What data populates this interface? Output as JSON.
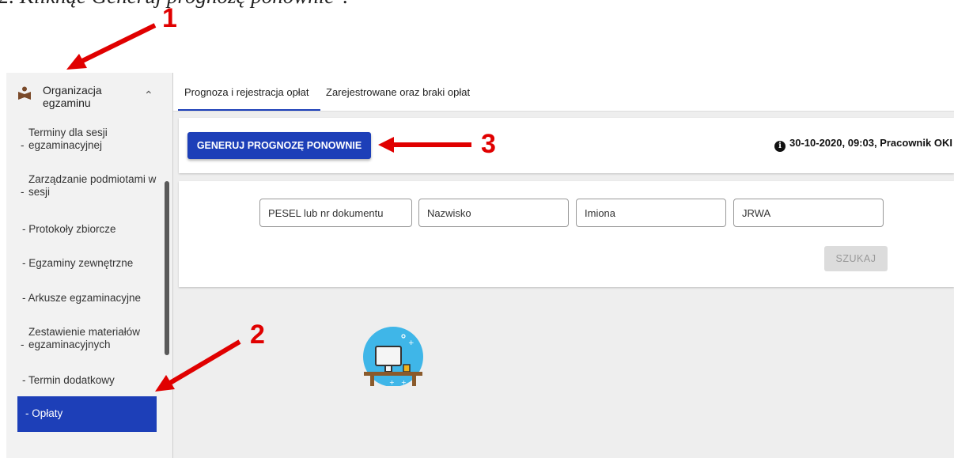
{
  "caption": "2.   Kliknąć Generuj prognozę ponownie\".",
  "sidebar": {
    "section_title": "Organizacja egzaminu",
    "items": [
      {
        "label": "Terminy dla sesji egzaminacyjnej"
      },
      {
        "label": "Zarządzanie podmiotami w sesji"
      },
      {
        "label": "- Protokoły zbiorcze"
      },
      {
        "label": "- Egzaminy zewnętrzne"
      },
      {
        "label": "- Arkusze egzaminacyjne"
      },
      {
        "label": "Zestawienie materiałów egzaminacyjnych"
      },
      {
        "label": "- Termin dodatkowy"
      },
      {
        "label": "- Opłaty"
      }
    ]
  },
  "tabs": [
    {
      "label": "Prognoza i rejestracja opłat"
    },
    {
      "label": "Zarejestrowane oraz braki opłat"
    }
  ],
  "generate_button": "GENERUJ PROGNOZĘ PONOWNIE",
  "status_text": "30-10-2020, 09:03, Pracownik OKI",
  "filters": {
    "pesel": "PESEL lub nr dokumentu",
    "surname": "Nazwisko",
    "names": "Imiona",
    "jrwa": "JRWA"
  },
  "search_button": "SZUKAJ",
  "annotations": [
    "1",
    "2",
    "3"
  ],
  "colors": {
    "accent": "#1d3fb8",
    "annotation": "#e00000"
  }
}
